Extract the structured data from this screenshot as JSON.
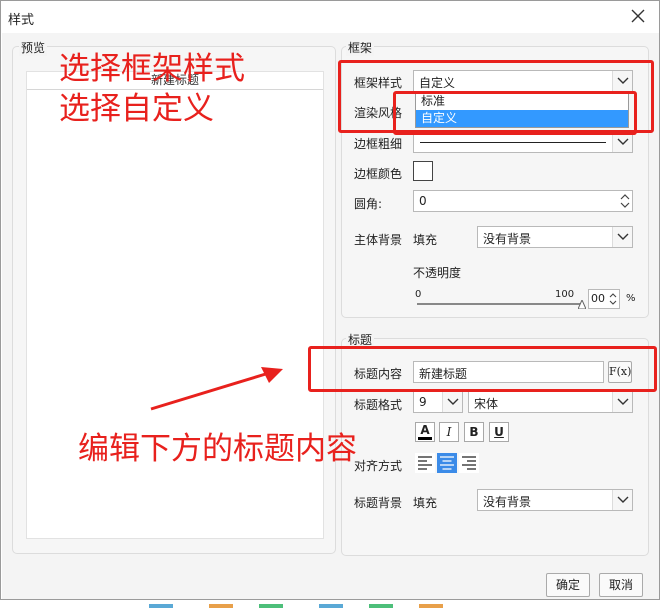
{
  "window": {
    "title": "样式"
  },
  "preview": {
    "label": "预览",
    "chart_title": "新建标题"
  },
  "frame": {
    "section_label": "框架",
    "frame_style_label": "框架样式",
    "frame_style_value": "自定义",
    "frame_style_options": [
      "标准",
      "自定义"
    ],
    "render_style_label": "渲染风格",
    "border_width_label": "边框粗细",
    "border_color_label": "边框颜色",
    "corner_label": "圆角:",
    "corner_value": "0",
    "body_bg_label": "主体背景",
    "body_bg_fill_label": "填充",
    "body_bg_value": "没有背景",
    "opacity_label": "不透明度",
    "opacity_min": "0",
    "opacity_max": "100",
    "opacity_input": "00",
    "opacity_unit": "%",
    "opacity_percent": 100
  },
  "title_section": {
    "section_label": "标题",
    "content_label": "标题内容",
    "content_value": "新建标题",
    "formula_button": "F(x)",
    "format_label": "标题格式",
    "font_size": "9",
    "font_name": "宋体",
    "bold_label": "B",
    "italic_label": "I",
    "underline_label": "U",
    "color_label": "A",
    "align_label": "对齐方式",
    "bg_label": "标题背景",
    "bg_fill_label": "填充",
    "bg_value": "没有背景"
  },
  "buttons": {
    "ok": "确定",
    "cancel": "取消"
  },
  "annotations": {
    "line1": "选择框架样式",
    "line2": "选择自定义",
    "line3": "编辑下方的标题内容"
  },
  "colors": {
    "annotation_red": "#e8211d",
    "selection_blue": "#3399ff",
    "active_align_blue": "#3b8be8"
  }
}
